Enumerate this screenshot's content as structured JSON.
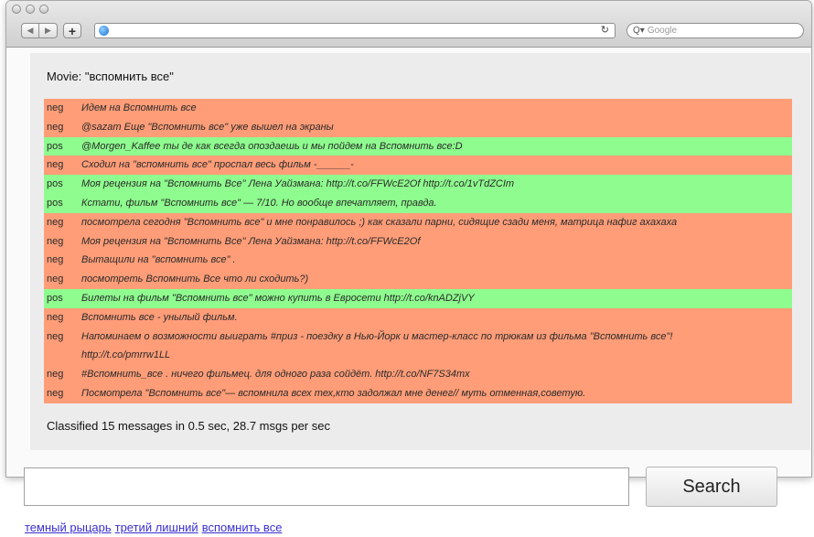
{
  "browser": {
    "search_placeholder": "Google"
  },
  "movie_label": "Movie: \"вспомнить все\"",
  "results": [
    {
      "label": "neg",
      "text": "Идем на Вспомнить все"
    },
    {
      "label": "neg",
      "text": "@sazam Еще \"Вспомнить все\" уже вышел на экраны"
    },
    {
      "label": "pos",
      "text": "@Morgen_Kaffee ты де как всегда опоздаешь и мы пойдем на Вспомнить все:D"
    },
    {
      "label": "neg",
      "text": "Сходил на \"вспомнить все\" проспал весь фильм -______-"
    },
    {
      "label": "pos",
      "text": "Моя рецензия на \"Вспомнить Все\" Лена Уайзмана: http://t.co/FFWcE2Of http://t.co/1vTdZCIm"
    },
    {
      "label": "pos",
      "text": "Кстати, фильм \"Вспомнить все\" — 7/10. Но вообще впечатляет, правда."
    },
    {
      "label": "neg",
      "text": "посмотрела сегодня \"Вспомнить все\" и мне понравилось ;) как сказали парни, сидящие сзади меня, матрица нафиг ахахаха"
    },
    {
      "label": "neg",
      "text": "Моя рецензия на \"Вспомнить Все\" Лена Уайзмана: http://t.co/FFWcE2Of"
    },
    {
      "label": "neg",
      "text": "Вытащили на \"вспомнить все\" ."
    },
    {
      "label": "neg",
      "text": "посмотреть Вспомнить Все что ли сходить?)"
    },
    {
      "label": "pos",
      "text": "Билеты на фильм \"Вспомнить все\" можно купить в Евросети http://t.co/knADZjVY"
    },
    {
      "label": "neg",
      "text": "Вспомнить все - унылый фильм."
    },
    {
      "label": "neg",
      "text": "Напоминаем о возможности выиграть #приз - поездку в Нью-Йорк и мастер-класс по трюкам из фильма \"Вспомнить все\"!"
    },
    {
      "label": "",
      "text": "http://t.co/pmrrw1LL"
    },
    {
      "label": "neg",
      "text": "#Вспомнить_все . ничего фильмец. для одного раза сойдёт. http://t.co/NF7S34mx"
    },
    {
      "label": "neg",
      "text": "Посмотрела \"Вспомнить все\"— вспомнила всех тех,кто задолжал мне денег// муть отменная,советую."
    }
  ],
  "summary": "Classified 15 messages in 0.5 sec, 28.7 msgs per sec",
  "search_button": "Search",
  "links": [
    "темный рыцарь",
    "третий лишний",
    "вспомнить все"
  ],
  "colors": {
    "neg": "#ff9d78",
    "pos": "#8efc8e"
  }
}
